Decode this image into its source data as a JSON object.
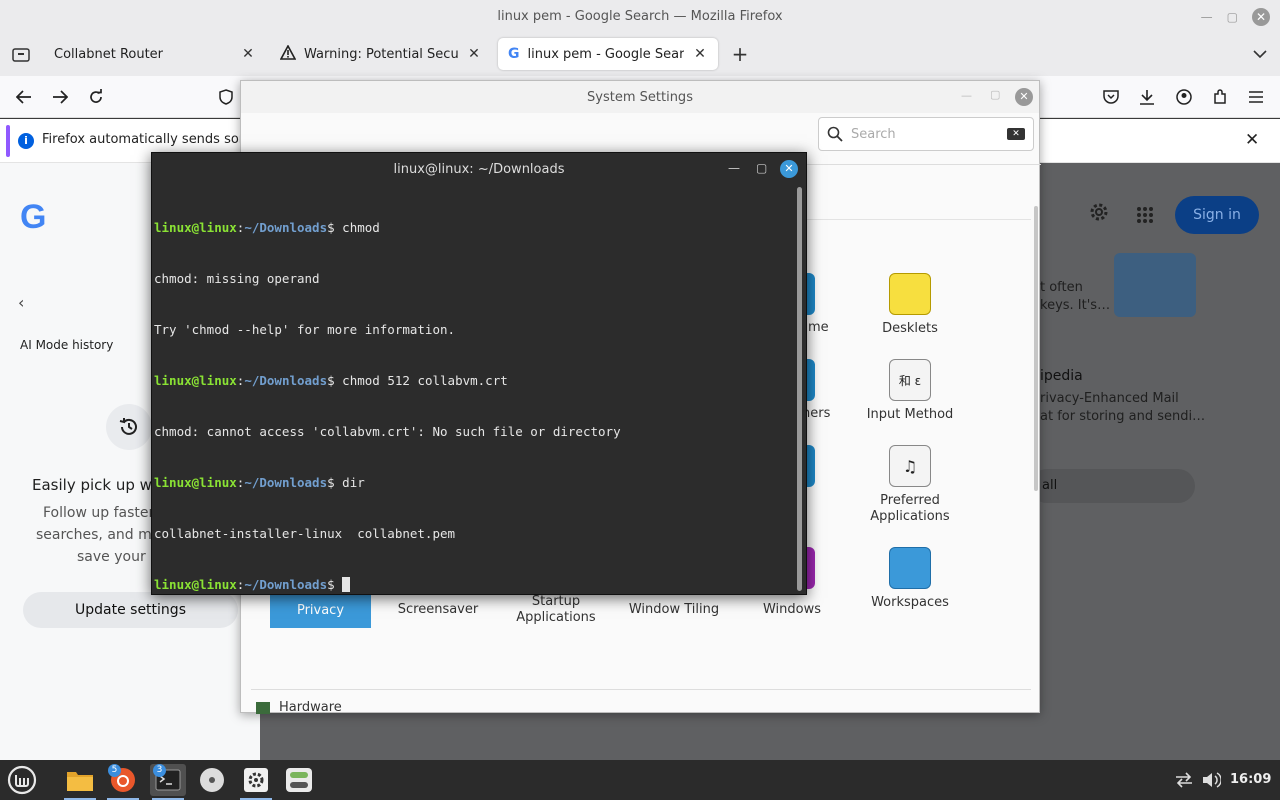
{
  "firefox": {
    "window_title": "linux pem - Google Search — Mozilla Firefox",
    "tabs": [
      {
        "label": "Collabnet Router",
        "active": false
      },
      {
        "label": "Warning: Potential Security",
        "active": false
      },
      {
        "label": "linux pem - Google Search",
        "active": true
      }
    ],
    "notification": "Firefox automatically sends some"
  },
  "google": {
    "ai_mode_history": "AI Mode history",
    "pickup_title": "Easily pick up where",
    "pickup_line1": "Follow up faster,",
    "pickup_line2": "searches, and mor",
    "pickup_line3": "save your hi",
    "update_settings": "Update settings",
    "sign_in": "Sign in",
    "snippet1_l1": "t often",
    "snippet1_l2": "keys. It's…",
    "snippet2_title": "ipedia",
    "snippet2_l1": "rivacy-Enhanced Mail",
    "snippet2_l2": "at for storing and sendi…",
    "snippet3": "all"
  },
  "settings": {
    "title": "System Settings",
    "search_placeholder": "Search",
    "partial_labels": [
      "me",
      "hers"
    ],
    "items_right": [
      {
        "label": "Desklets",
        "icon": "desklets-icon"
      },
      {
        "label": "Input Method",
        "icon": "input-method-icon"
      },
      {
        "label": "Preferred Applications",
        "icon": "preferred-apps-icon"
      },
      {
        "label": "Workspaces",
        "icon": "workspaces-icon"
      }
    ],
    "bottom_row": [
      "Privacy",
      "Screensaver",
      "Startup Applications",
      "Window Tiling",
      "Windows"
    ],
    "section_hardware": "Hardware",
    "accent": "#3b99d9"
  },
  "terminal": {
    "title": "linux@linux: ~/Downloads",
    "lines": [
      {
        "type": "prompt",
        "user": "linux@linux",
        "path": "~/Downloads",
        "cmd": " chmod"
      },
      {
        "type": "out",
        "text": "chmod: missing operand"
      },
      {
        "type": "out",
        "text": "Try 'chmod --help' for more information."
      },
      {
        "type": "prompt",
        "user": "linux@linux",
        "path": "~/Downloads",
        "cmd": " chmod 512 collabvm.crt"
      },
      {
        "type": "out",
        "text": "chmod: cannot access 'collabvm.crt': No such file or directory"
      },
      {
        "type": "prompt",
        "user": "linux@linux",
        "path": "~/Downloads",
        "cmd": " dir"
      },
      {
        "type": "out",
        "text": "collabnet-installer-linux  collabnet.pem"
      },
      {
        "type": "prompt",
        "user": "linux@linux",
        "path": "~/Downloads",
        "cmd": " "
      }
    ]
  },
  "taskbar": {
    "time": "16:09",
    "badge_firefox": "5",
    "badge_terminal": "3"
  }
}
